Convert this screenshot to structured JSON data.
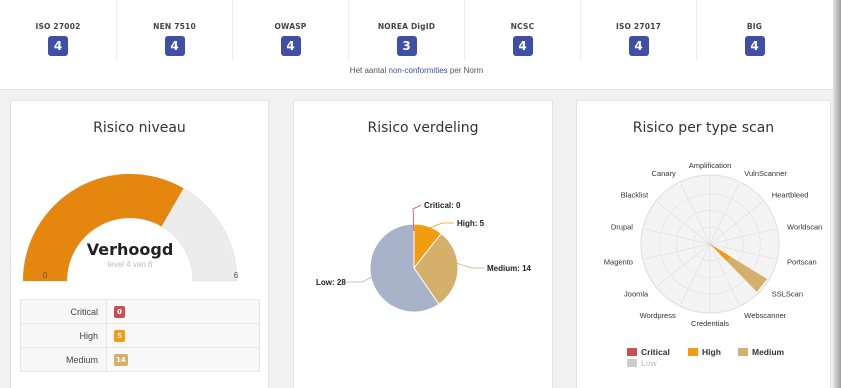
{
  "norms": [
    {
      "label": "ISO 27002",
      "count": "4"
    },
    {
      "label": "NEN 7510",
      "count": "4"
    },
    {
      "label": "OWASP",
      "count": "4"
    },
    {
      "label": "NOREA DigID",
      "count": "3"
    },
    {
      "label": "NCSC",
      "count": "4"
    },
    {
      "label": "ISO 27017",
      "count": "4"
    },
    {
      "label": "BIG",
      "count": "4"
    }
  ],
  "norms_caption": {
    "prefix": "Het aantal ",
    "link": "non-conformities",
    "suffix": " per Norm"
  },
  "colors": {
    "accent": "#3f4fa6",
    "critical": "#c9504e",
    "high": "#f39c12",
    "medium": "#d4b06a",
    "low": "#a8b2c8",
    "gauge_fill": "#e5860e",
    "gauge_track": "#ececec"
  },
  "risk_level": {
    "title": "Risico niveau",
    "label": "Verhoogd",
    "sublabel": "level 4 van 6",
    "min_label": "0",
    "max_label": "6",
    "value": 4,
    "max": 6,
    "rows": [
      {
        "label": "Critical",
        "value": "0",
        "color": "#c9504e"
      },
      {
        "label": "High",
        "value": "5",
        "color": "#f39c12"
      },
      {
        "label": "Medium",
        "value": "14",
        "color": "#d4b06a"
      }
    ]
  },
  "risk_distribution": {
    "title": "Risico verdeling",
    "labels": {
      "critical": "Critical: 0",
      "high": "High: 5",
      "medium": "Medium: 14",
      "low": "Low: 28"
    }
  },
  "scan_types": {
    "title": "Risico per type scan",
    "legend": [
      {
        "name": "Critical",
        "color": "#c9504e"
      },
      {
        "name": "High",
        "color": "#f39c12"
      },
      {
        "name": "Medium",
        "color": "#d4b06a"
      },
      {
        "name": "Low",
        "color": "#cccccc"
      }
    ]
  },
  "chart_data": [
    {
      "type": "pie",
      "categories": [
        "Critical",
        "High",
        "Medium",
        "Low"
      ],
      "values": [
        0,
        5,
        14,
        28
      ],
      "colors": [
        "#c9504e",
        "#f39c12",
        "#d4b06a",
        "#a8b2c8"
      ]
    },
    {
      "type": "radar",
      "categories": [
        "Amplification",
        "VulnScanner",
        "Heartbleed",
        "Worldscan",
        "Portscan",
        "SSLScan",
        "Webscanner",
        "Credentials",
        "Wordpress",
        "Joomla",
        "Magento",
        "Drupal",
        "Blacklist",
        "Canary"
      ],
      "series": [
        {
          "name": "High",
          "values": [
            0,
            0,
            0,
            0,
            0,
            5,
            0,
            0,
            0,
            0,
            0,
            0,
            0,
            0
          ]
        },
        {
          "name": "Medium",
          "values": [
            0,
            0,
            0,
            0,
            0,
            14,
            0,
            0,
            0,
            0,
            0,
            0,
            0,
            0
          ]
        }
      ]
    }
  ]
}
